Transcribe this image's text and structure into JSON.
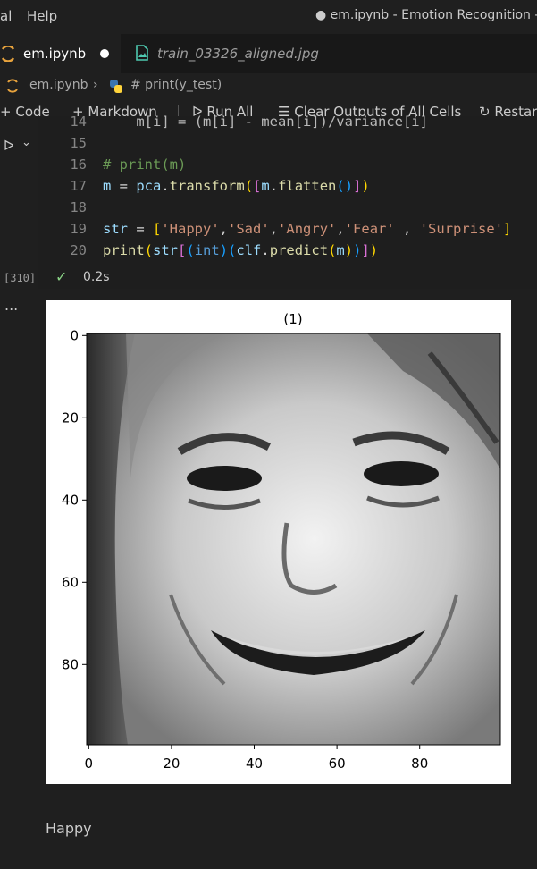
{
  "menu": {
    "items": [
      "al",
      "Help"
    ]
  },
  "window": {
    "title": "● em.ipynb - Emotion Recognition - V"
  },
  "tabs": [
    {
      "label": "em.ipynb",
      "state": "modified",
      "active": true
    },
    {
      "label": "train_03326_aligned.jpg",
      "active": false
    }
  ],
  "breadcrumb": {
    "file": "em.ipynb",
    "symbol": "# print(y_test)"
  },
  "toolbar": {
    "code_label": "Code",
    "markdown_label": "Markdown",
    "run_all_label": "Run All",
    "clear_outputs_label": "Clear Outputs of All Cells",
    "restart_label": "Restar"
  },
  "cell": {
    "lines": [
      {
        "n": "14",
        "text": "    m[i] = (m[i] - mean[i])/variance[i]"
      },
      {
        "n": "15",
        "text": ""
      },
      {
        "n": "16",
        "text": "# print(m)"
      },
      {
        "n": "17",
        "text": "m = pca.transform([m.flatten()])"
      },
      {
        "n": "18",
        "text": ""
      },
      {
        "n": "19",
        "text": "str = ['Happy','Sad','Angry','Fear' , 'Surprise']"
      },
      {
        "n": "20",
        "text": "print(str[(int)(clf.predict(m))])"
      }
    ],
    "execution_count": "[310]",
    "execution_time": "0.2s"
  },
  "output": {
    "more_label": "...",
    "figure": {
      "title": "(1)",
      "x_ticks": [
        "0",
        "20",
        "40",
        "60",
        "80"
      ],
      "y_ticks": [
        "0",
        "20",
        "40",
        "60",
        "80"
      ],
      "image": "grayscale 100x100 face photo (smiling child)"
    },
    "text": "Happy"
  },
  "colors": {
    "background": "#1f1f1f",
    "accent": "#0078d4",
    "modified_dot": "#ffffff",
    "notebook_icon": "#e8a33d",
    "image_icon": "#4ec9b0"
  }
}
